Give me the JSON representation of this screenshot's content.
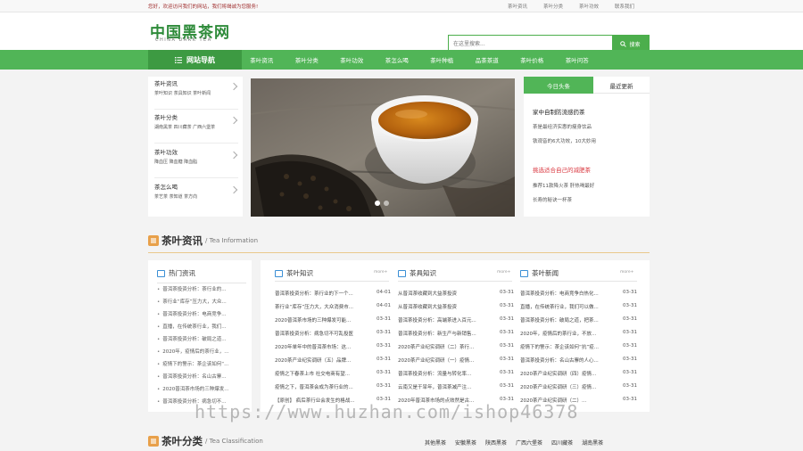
{
  "topbar": {
    "welcome": "您好，欢迎访问我们的网站，我们将竭诚为您服务!",
    "links": [
      "茶叶资讯",
      "茶叶分类",
      "茶叶功效",
      "联系我们"
    ]
  },
  "header": {
    "logo_cn": "中国黑茶网",
    "logo_en": "CHINA DARK TEA",
    "search_placeholder": "在这里搜索...",
    "search_button": "搜索"
  },
  "nav": {
    "head": "网站导航",
    "items": [
      "茶叶资讯",
      "茶叶分类",
      "茶叶功效",
      "茶怎么喝",
      "茶叶种植",
      "品茶茶道",
      "茶叶价格",
      "茶叶问答"
    ]
  },
  "categories": [
    {
      "title": "茶叶资讯",
      "sub": "茶叶知识 茶具知识 茶叶新闻"
    },
    {
      "title": "茶叶分类",
      "sub": "湖南黑茶 四川藏茶 广西六堡茶"
    },
    {
      "title": "茶叶功效",
      "sub": "降血压 降血糖 降血脂"
    },
    {
      "title": "茶怎么喝",
      "sub": "茶艺茶 茶知道 茶方向"
    }
  ],
  "headlines": {
    "tab_active": "今日头条",
    "tab_other": "最近更新",
    "top1": "家中自制防流感药茶",
    "top1_items": [
      "茶是最经济实惠的瘦身饮品",
      "铁观音的6大功效，10大妙用"
    ],
    "top2": "挑选适合自己的减肥茶",
    "top2_items": [
      "推荐11款降火茶 肝热喝最好",
      "长寿的秘诀一杯茶"
    ]
  },
  "section_info": {
    "cn": "茶叶资讯",
    "en": "/ Tea Information"
  },
  "hot": {
    "title": "热门资讯",
    "items": [
      "普洱茶投资分析：茶行业的...",
      "茶行业“库存”压力大，大众...",
      "普洱茶投资分析：电商竞争...",
      "直播，在传统茶行业，我们...",
      "普洱茶投资分析：破局之道...",
      "2020年，疫情后的茶行业，...",
      "疫情下的警示：茶企该如何“...",
      "普洱茶投资分析：名山古寨...",
      "2020普洱茶市场的三种爆发...",
      "普洱茶投资分析：病急切不..."
    ]
  },
  "columns": [
    {
      "title": "茶叶知识",
      "more": "more+",
      "rows": [
        {
          "t": "普洱茶投资分析：茶行业的下一个...",
          "d": "04-01"
        },
        {
          "t": "茶行业“库存”压力大，大众消费市...",
          "d": "04-01"
        },
        {
          "t": "2020普洱茶市场的三种爆发可能...",
          "d": "03-31"
        },
        {
          "t": "普洱茶投资分析：病急切不可乱投医",
          "d": "03-31"
        },
        {
          "t": "2020年单年中的普洱茶市场：这...",
          "d": "03-31"
        },
        {
          "t": "2020茶产业纪实调研（五）品牌...",
          "d": "03-31"
        },
        {
          "t": "疫情之下春茶上市 社交电商有望...",
          "d": "03-31"
        },
        {
          "t": "疫情之下，普洱茶会成为茶行业的...",
          "d": "03-31"
        },
        {
          "t": "【原创】 疯后茶行业会发生的格战...",
          "d": "03-31"
        }
      ]
    },
    {
      "title": "茶具知识",
      "more": "more+",
      "rows": [
        {
          "t": "从普洱茶收藏到大益茶投资",
          "d": "03-31"
        },
        {
          "t": "从普洱茶收藏到大益茶投资",
          "d": "03-31"
        },
        {
          "t": "普洱茶投资分析：高端茶进入百元...",
          "d": "03-31"
        },
        {
          "t": "普洱茶投资分析：新生产与新销售...",
          "d": "03-31"
        },
        {
          "t": "2020茶产业纪实调研（二）茶行...",
          "d": "03-31"
        },
        {
          "t": "2020茶产业纪实调研（一）疫情...",
          "d": "03-31"
        },
        {
          "t": "普洱茶投资分析：流量与转化率...",
          "d": "03-31"
        },
        {
          "t": "云南又是干旱年，普洱茶减产注...",
          "d": "03-31"
        },
        {
          "t": "2020年普洱茶市场的点效然是古...",
          "d": "03-31"
        }
      ]
    },
    {
      "title": "茶叶新闻",
      "more": "more+",
      "rows": [
        {
          "t": "普洱茶投资分析：电商竞争白热化...",
          "d": "03-31"
        },
        {
          "t": "直播，在传统茶行业，我们可以做...",
          "d": "03-31"
        },
        {
          "t": "普洱茶投资分析：破局之道，把茶...",
          "d": "03-31"
        },
        {
          "t": "2020年，疫情后的茶行业，不放...",
          "d": "03-31"
        },
        {
          "t": "疫情下的警示：茶企该如何“抗”疫...",
          "d": "03-31"
        },
        {
          "t": "普洱茶投资分析：名山古寨的人心...",
          "d": "03-31"
        },
        {
          "t": "2020茶产业纪实调研（四）疫情...",
          "d": "03-31"
        },
        {
          "t": "2020茶产业纪实调研（三）疫情...",
          "d": "03-31"
        },
        {
          "t": "2020茶产业纪实调研（二）...",
          "d": "03-31"
        }
      ]
    }
  ],
  "section_class": {
    "cn": "茶叶分类",
    "en": "/ Tea Classification",
    "links": [
      "其他黑茶",
      "安徽黑茶",
      "陕西黑茶",
      "广西六堡茶",
      "四川藏茶",
      "湖南黑茶"
    ]
  },
  "watermark": "https://www.huzhan.com/ishop46378"
}
